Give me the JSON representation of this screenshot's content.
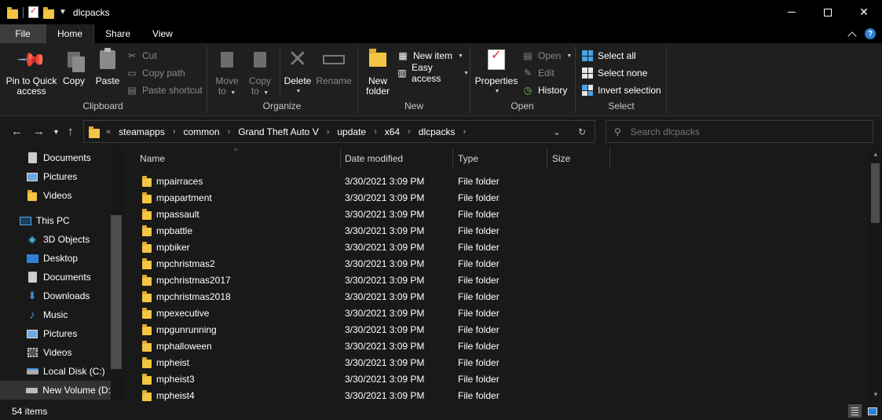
{
  "window": {
    "title": "dlcpacks"
  },
  "tabs": [
    {
      "label": "File"
    },
    {
      "label": "Home"
    },
    {
      "label": "Share"
    },
    {
      "label": "View"
    }
  ],
  "ribbon": {
    "clipboard": {
      "label": "Clipboard",
      "pin": "Pin to Quick access",
      "pin_line1": "Pin to Quick",
      "pin_line2": "access",
      "copy": "Copy",
      "paste": "Paste",
      "cut": "Cut",
      "copy_path": "Copy path",
      "paste_shortcut": "Paste shortcut"
    },
    "organize": {
      "label": "Organize",
      "move_to_line1": "Move",
      "move_to_line2": "to",
      "copy_to_line1": "Copy",
      "copy_to_line2": "to",
      "delete": "Delete",
      "rename": "Rename"
    },
    "new": {
      "label": "New",
      "new_folder_line1": "New",
      "new_folder_line2": "folder",
      "new_item": "New item",
      "easy_access": "Easy access"
    },
    "open": {
      "label": "Open",
      "properties": "Properties",
      "open": "Open",
      "edit": "Edit",
      "history": "History"
    },
    "select": {
      "label": "Select",
      "select_all": "Select all",
      "select_none": "Select none",
      "invert_selection": "Invert selection"
    }
  },
  "address": {
    "overflow": "«",
    "crumbs": [
      "steamapps",
      "common",
      "Grand Theft Auto V",
      "update",
      "x64",
      "dlcpacks"
    ],
    "search_placeholder": "Search dlcpacks"
  },
  "sidebar": {
    "items": [
      {
        "label": "Documents",
        "icon": "documents-icon"
      },
      {
        "label": "Pictures",
        "icon": "pictures-icon"
      },
      {
        "label": "Videos",
        "icon": "folder-icon"
      },
      {
        "label": "This PC",
        "icon": "computer-icon"
      },
      {
        "label": "3D Objects",
        "icon": "cube-icon"
      },
      {
        "label": "Desktop",
        "icon": "desktop-icon"
      },
      {
        "label": "Documents",
        "icon": "documents-icon"
      },
      {
        "label": "Downloads",
        "icon": "download-arrow-icon"
      },
      {
        "label": "Music",
        "icon": "music-note-icon"
      },
      {
        "label": "Pictures",
        "icon": "pictures-icon"
      },
      {
        "label": "Videos",
        "icon": "film-icon"
      },
      {
        "label": "Local Disk (C:)",
        "icon": "disk-icon"
      },
      {
        "label": "New Volume (D:",
        "icon": "drive-icon"
      }
    ]
  },
  "columns": {
    "name": "Name",
    "date": "Date modified",
    "type": "Type",
    "size": "Size"
  },
  "files": [
    {
      "name": "mpairraces",
      "date": "3/30/2021 3:09 PM",
      "type": "File folder"
    },
    {
      "name": "mpapartment",
      "date": "3/30/2021 3:09 PM",
      "type": "File folder"
    },
    {
      "name": "mpassault",
      "date": "3/30/2021 3:09 PM",
      "type": "File folder"
    },
    {
      "name": "mpbattle",
      "date": "3/30/2021 3:09 PM",
      "type": "File folder"
    },
    {
      "name": "mpbiker",
      "date": "3/30/2021 3:09 PM",
      "type": "File folder"
    },
    {
      "name": "mpchristmas2",
      "date": "3/30/2021 3:09 PM",
      "type": "File folder"
    },
    {
      "name": "mpchristmas2017",
      "date": "3/30/2021 3:09 PM",
      "type": "File folder"
    },
    {
      "name": "mpchristmas2018",
      "date": "3/30/2021 3:09 PM",
      "type": "File folder"
    },
    {
      "name": "mpexecutive",
      "date": "3/30/2021 3:09 PM",
      "type": "File folder"
    },
    {
      "name": "mpgunrunning",
      "date": "3/30/2021 3:09 PM",
      "type": "File folder"
    },
    {
      "name": "mphalloween",
      "date": "3/30/2021 3:09 PM",
      "type": "File folder"
    },
    {
      "name": "mpheist",
      "date": "3/30/2021 3:09 PM",
      "type": "File folder"
    },
    {
      "name": "mpheist3",
      "date": "3/30/2021 3:09 PM",
      "type": "File folder"
    },
    {
      "name": "mpheist4",
      "date": "3/30/2021 3:09 PM",
      "type": "File folder"
    }
  ],
  "status": {
    "item_count": "54 items"
  },
  "colors": {
    "background": "#191919",
    "titlebar": "#000000",
    "folder": "#f4c542",
    "accent": "#2d7fd3"
  }
}
